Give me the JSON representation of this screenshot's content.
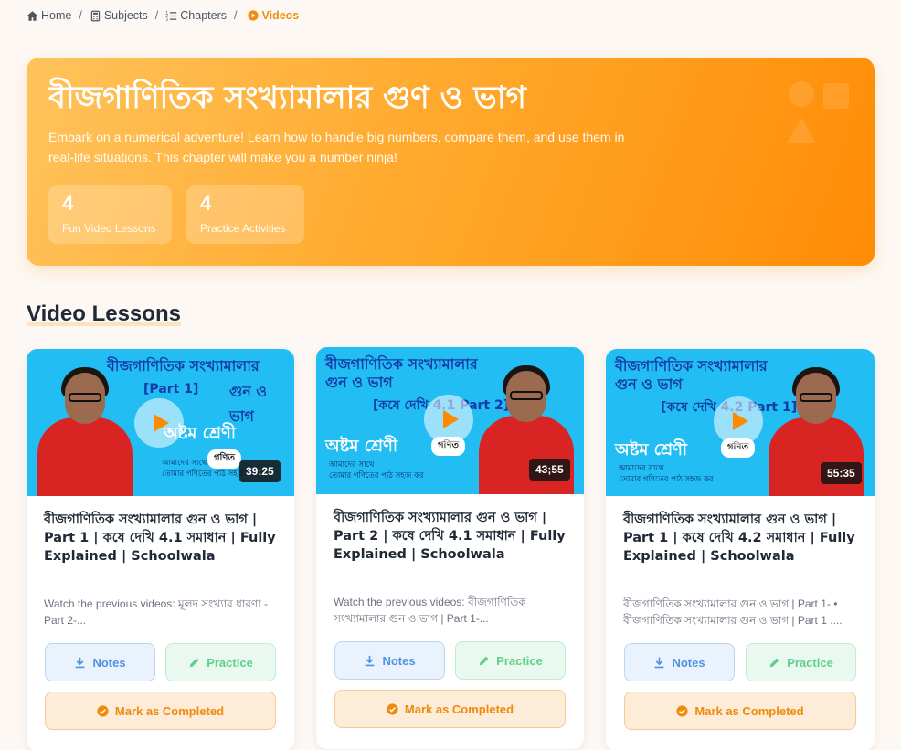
{
  "breadcrumb": {
    "home": "Home",
    "subjects": "Subjects",
    "chapters": "Chapters",
    "current": "Videos"
  },
  "hero": {
    "title": "বীজগাণিতিক সংখ্যামালার গুণ ও ভাগ",
    "description": "Embark on a numerical adventure! Learn how to handle big numbers, compare them, and use them in real-life situations. This chapter will make you a number ninja!",
    "stats": [
      {
        "value": "4",
        "label": "Fun Video Lessons"
      },
      {
        "value": "4",
        "label": "Practice Activities"
      }
    ]
  },
  "section_title": "Video Lessons",
  "videos": [
    {
      "thumb_title": "বীজগাণিতিক সংখ্যামালার",
      "thumb_title2": "গুন ও ভাগ",
      "thumb_part": "[Part 1]",
      "thumb_class": "অষ্টম শ্রেণী",
      "thumb_badge": "গণিত",
      "thumb_sub1": "আমাদের সাথে",
      "thumb_sub2": "তোমার গণিতের পাঠ সহজ কর",
      "duration": "39:25",
      "title": "বীজগাণিতিক সংখ্যামালার গুন ও ভাগ | Part 1 | কষে দেখি 4.1 সমাধান | Fully Explained | Schoolwala",
      "description": "Watch the previous videos: মূলদ সংখ্যার ধারণা - Part 2-...",
      "notes_label": "Notes",
      "practice_label": "Practice",
      "complete_label": "Mark as Completed"
    },
    {
      "thumb_title": "বীজগাণিতিক সংখ্যামালার",
      "thumb_title2": "গুন ও ভাগ",
      "thumb_part": "[কষে দেখি 4.1 Part 2]",
      "thumb_class": "অষ্টম শ্রেণী",
      "thumb_badge": "গণিত",
      "thumb_sub1": "আমাদের সাথে",
      "thumb_sub2": "তোমার গণিতের পাঠ সহজ কর",
      "duration": "43;55",
      "title": "বীজগাণিতিক সংখ্যামালার গুন ও ভাগ | Part 2 | কষে দেখি 4.1 সমাধান | Fully Explained | Schoolwala",
      "description": "Watch the previous videos: বীজগাণিতিক সংখ্যামালার গুন ও ভাগ | Part 1-...",
      "notes_label": "Notes",
      "practice_label": "Practice",
      "complete_label": "Mark as Completed"
    },
    {
      "thumb_title": "বীজগাণিতিক সংখ্যামালার",
      "thumb_title2": "গুন ও ভাগ",
      "thumb_part": "[কষে দেখি 4.2 Part 1]",
      "thumb_class": "অষ্টম শ্রেণী",
      "thumb_badge": "গণিত",
      "thumb_sub1": "আমাদের সাথে",
      "thumb_sub2": "তোমার গণিতের পাঠ সহজ কর",
      "duration": "55:35",
      "title": "বীজগাণিতিক সংখ্যামালার গুন ও ভাগ | Part 1 | কষে দেখি 4.2 সমাধান | Fully Explained | Schoolwala",
      "description": "বীজগাণিতিক সংখ্যামালার গুন ও ভাগ | Part 1- • বীজগাণিতিক সংখ্যামালার গুন ও ভাগ | Part 1 ....",
      "notes_label": "Notes",
      "practice_label": "Practice",
      "complete_label": "Mark as Completed"
    }
  ],
  "colors": {
    "accent": "#f28c12",
    "hero_start": "#ffc35c",
    "hero_end": "#ff8c05",
    "thumb_bg": "#22bdf2"
  }
}
